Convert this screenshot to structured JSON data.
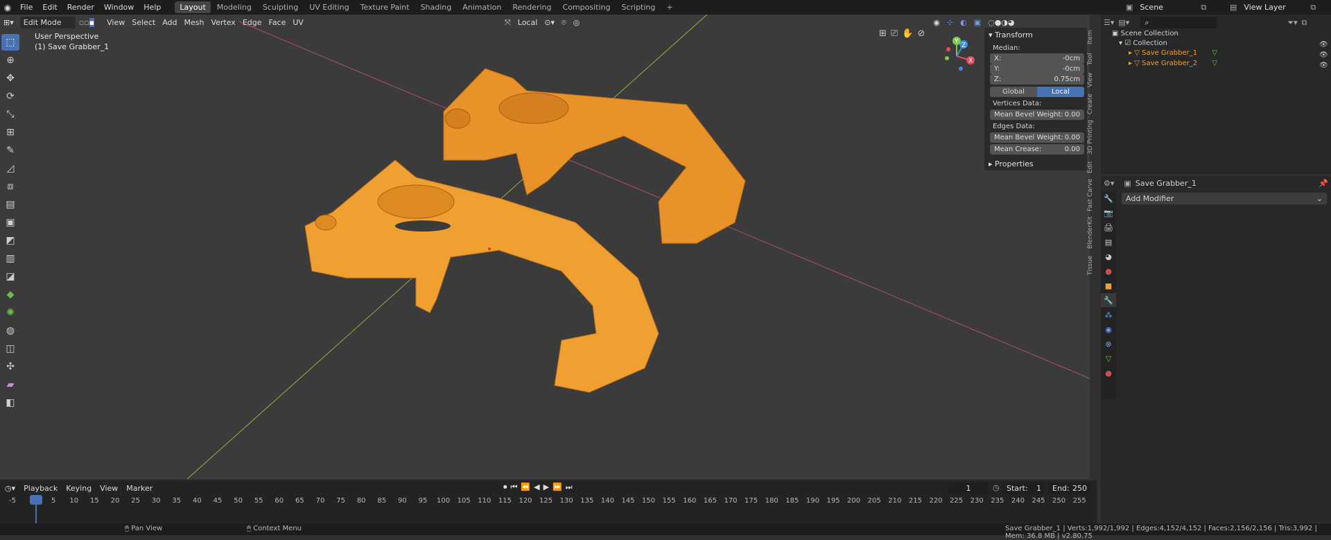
{
  "menubar": {
    "items": [
      "File",
      "Edit",
      "Render",
      "Window",
      "Help"
    ],
    "workspaces": [
      "Layout",
      "Modeling",
      "Sculpting",
      "UV Editing",
      "Texture Paint",
      "Shading",
      "Animation",
      "Rendering",
      "Compositing",
      "Scripting"
    ],
    "active_workspace": "Layout",
    "add_tab": "+",
    "scene": "Scene",
    "view_layer": "View Layer"
  },
  "viewport": {
    "mode": "Edit Mode",
    "menus": [
      "View",
      "Select",
      "Add",
      "Mesh",
      "Vertex",
      "Edge",
      "Face",
      "UV"
    ],
    "transform_orientation": "Local",
    "perspective": "User Perspective",
    "active_object": "(1) Save Grabber_1"
  },
  "gizmo": {
    "x": "X",
    "y": "Y",
    "z": "Z",
    "x_color": "#e84a5f",
    "y_color": "#7ec94b",
    "z_color": "#3e8de0"
  },
  "npanel": {
    "transform": "Transform",
    "median": "Median:",
    "x_label": "X:",
    "x_value": "-0cm",
    "y_label": "Y:",
    "y_value": "-0cm",
    "z_label": "Z:",
    "z_value": "0.75cm",
    "global": "Global",
    "local": "Local",
    "vertices_data": "Vertices Data:",
    "mean_bevel_label": "Mean Bevel Weight:",
    "mean_bevel_v": "0.00",
    "edges_data": "Edges Data:",
    "edge_bevel_label": "Mean Bevel Weight:",
    "edge_bevel_v": "0.00",
    "crease_label": "Mean Crease:",
    "crease_v": "0.00",
    "properties": "Properties"
  },
  "side_tabs": [
    "Item",
    "Tool",
    "View",
    "Create",
    "3D Printing",
    "Edit",
    "Fast Carve",
    "BlenderKit",
    "Tissue"
  ],
  "outliner": {
    "root": "Scene Collection",
    "collection": "Collection",
    "objects": [
      "Save Grabber_1",
      "Save Grabber_2"
    ]
  },
  "properties": {
    "object": "Save Grabber_1",
    "add_modifier": "Add Modifier"
  },
  "timeline": {
    "menus": [
      "Playback",
      "Keying",
      "View",
      "Marker"
    ],
    "current_frame": "1",
    "start_label": "Start:",
    "start": "1",
    "end_label": "End:",
    "end": "250",
    "ticks": [
      "-5",
      "1",
      "5",
      "10",
      "15",
      "20",
      "25",
      "30",
      "35",
      "40",
      "45",
      "50",
      "55",
      "60",
      "65",
      "70",
      "75",
      "80",
      "85",
      "90",
      "95",
      "100",
      "105",
      "110",
      "115",
      "120",
      "125",
      "130",
      "135",
      "140",
      "145",
      "150",
      "155",
      "160",
      "165",
      "170",
      "175",
      "180",
      "185",
      "190",
      "195",
      "200",
      "205",
      "210",
      "215",
      "220",
      "225",
      "230",
      "235",
      "240",
      "245",
      "250",
      "255"
    ]
  },
  "statusbar": {
    "pan": "Pan View",
    "context": "Context Menu",
    "stats": "Save Grabber_1 | Verts:1,992/1,992 | Edges:4,152/4,152 | Faces:2,156/2,156 | Tris:3,992 | Mem: 36.8 MB | v2.80.75"
  },
  "mesh_color": "#f0a030"
}
